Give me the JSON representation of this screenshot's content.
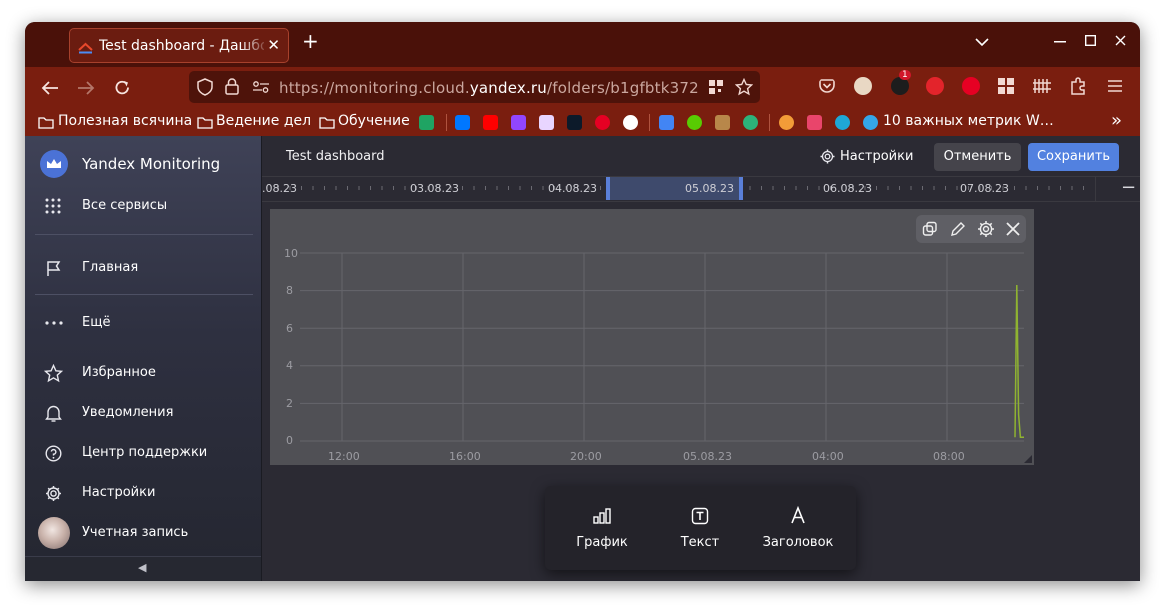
{
  "browser": {
    "tab_title": "Test dashboard - Дашборды",
    "tab_close": "✕",
    "new_tab": "+",
    "url_prefix": "https://monitoring.cloud.",
    "url_domain": "yandex.ru",
    "url_suffix": "/folders/b1gfbtk3726lm0",
    "badge_count": "1",
    "colors": {
      "tabstrip": "#4a1109",
      "toolbar": "#7a1e0f",
      "urlbar": "#4e130a"
    }
  },
  "bookmarks": {
    "items": [
      "Полезная всячина",
      "Ведение дел",
      "Обучение",
      "10 важных метрик W…"
    ],
    "overflow": "»"
  },
  "sidebar": {
    "app_title": "Yandex Monitoring",
    "all_services": "Все сервисы",
    "home": "Главная",
    "more": "Ещё",
    "favorites": "Избранное",
    "notifications": "Уведомления",
    "support": "Центр поддержки",
    "settings": "Настройки",
    "account": "Учетная запись",
    "collapse": "◀"
  },
  "header": {
    "title": "Test dashboard",
    "settings_label": "Настройки",
    "cancel_label": "Отменить",
    "save_label": "Сохранить",
    "accent": "#5281e0"
  },
  "timeline": {
    "labels": [
      ".08.23",
      "03.08.23",
      "04.08.23",
      "05.08.23",
      "06.08.23",
      "07.08.23"
    ],
    "zoom_out": "−",
    "zoom_in": "+"
  },
  "chart_data": {
    "type": "line",
    "y_ticks": [
      "10",
      "8",
      "6",
      "4",
      "2",
      "0"
    ],
    "x_ticks": [
      "12:00",
      "16:00",
      "20:00",
      "05.08.23",
      "04:00",
      "08:00"
    ],
    "ylim": [
      0,
      10
    ],
    "grid": true,
    "series": [
      {
        "color": "#8fb331",
        "points": [
          [
            0.0,
            0.2
          ],
          [
            0.2,
            8.3
          ],
          [
            0.4,
            1.4
          ],
          [
            0.6,
            0.2
          ],
          [
            1.0,
            0.2
          ]
        ]
      }
    ]
  },
  "add_widget": {
    "items": [
      {
        "label": "График",
        "icon": "chart-icon"
      },
      {
        "label": "Текст",
        "icon": "text-icon"
      },
      {
        "label": "Заголовок",
        "icon": "title-icon"
      }
    ]
  }
}
